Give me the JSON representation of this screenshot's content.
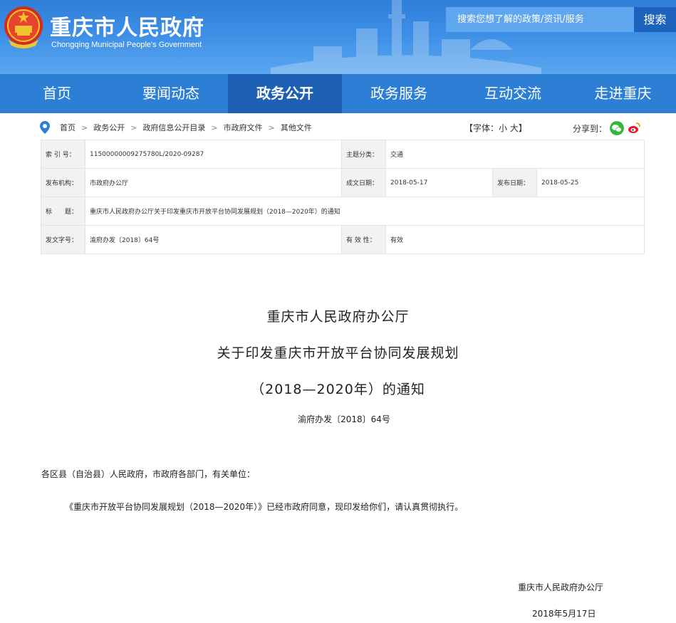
{
  "header": {
    "title": "重庆市人民政府",
    "subtitle": "Chongqing Municipal People's Government",
    "search_placeholder": "搜索您想了解的政策/资讯/服务",
    "search_button": "搜索"
  },
  "nav": [
    "首页",
    "要闻动态",
    "政务公开",
    "政务服务",
    "互动交流",
    "走进重庆"
  ],
  "nav_active": "政务公开",
  "breadcrumb": [
    "首页",
    "政务公开",
    "政府信息公开目录",
    "市政府文件",
    "其他文件"
  ],
  "breadcrumb_sep": ">",
  "font_size": {
    "prefix": "【字体：",
    "small": "小",
    "large": "大",
    "suffix": "】"
  },
  "share_label": "分享到：",
  "info": {
    "index_label": "索 引 号：",
    "index_value": "11500000009275780L/2020-09287",
    "category_label": "主题分类：",
    "category_value": "交通",
    "issuer_label": "发布机构：",
    "issuer_value": "市政府办公厅",
    "written_label": "成文日期：",
    "written_value": "2018-05-17",
    "published_label": "发布日期：",
    "published_value": "2018-05-25",
    "title_label": "标　　题：",
    "title_value": "重庆市人民政府办公厅关于印发重庆市开放平台协同发展规划（2018—2020年）的通知",
    "docno_label": "发文字号：",
    "docno_value": "渝府办发〔2018〕64号",
    "validity_label": "有 效 性：",
    "validity_value": "有效"
  },
  "document": {
    "title_line1": "重庆市人民政府办公厅",
    "title_line2": "关于印发重庆市开放平台协同发展规划",
    "title_line3": "（2018—2020年）的通知",
    "doc_number": "渝府办发〔2018〕64号",
    "addressee": "各区县（自治县）人民政府，市政府各部门，有关单位：",
    "body": "《重庆市开放平台协同发展规划（2018—2020年）》已经市政府同意，现印发给你们，请认真贯彻执行。",
    "signature": "重庆市人民政府办公厅",
    "date": "2018年5月17日"
  },
  "colors": {
    "header_blue": "#3c8ee6",
    "nav_blue": "#2d7fd6",
    "nav_active": "#1c5fb3",
    "search_button": "#1b63bd"
  }
}
